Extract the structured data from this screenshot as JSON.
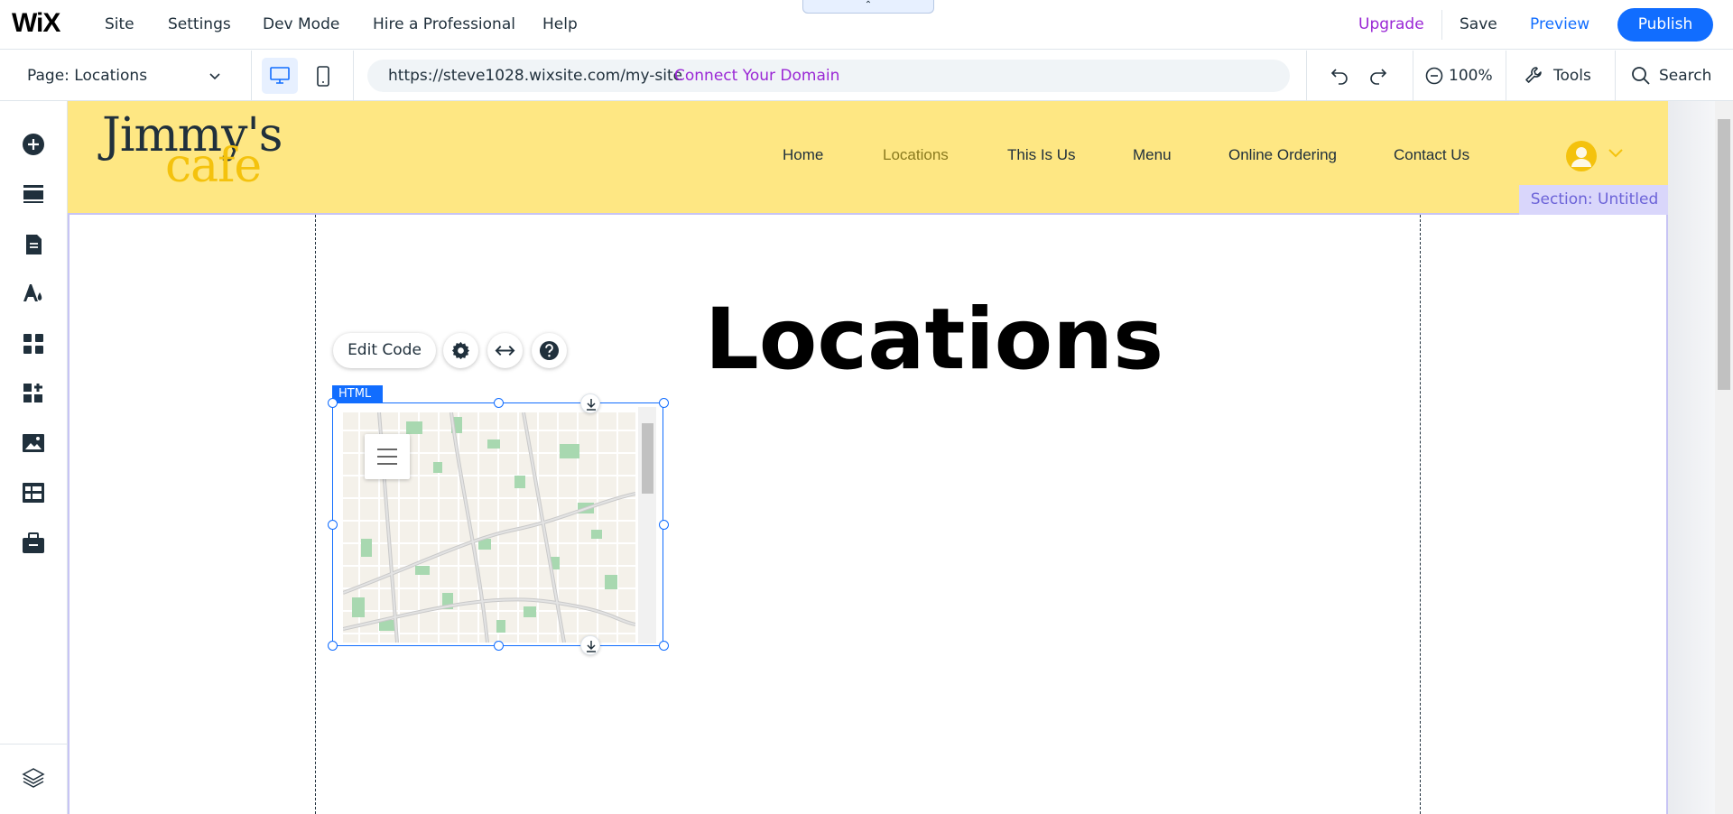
{
  "topbar": {
    "logo": "WiX",
    "nav": [
      "Site",
      "Settings",
      "Dev Mode",
      "Hire a Professional",
      "Help"
    ],
    "upgrade": "Upgrade",
    "save": "Save",
    "preview": "Preview",
    "publish": "Publish",
    "collapse_handle": "⌃"
  },
  "bar2": {
    "page_label": "Page: Locations",
    "url": "https://steve1028.wixsite.com/my-site",
    "connect_domain": "Connect Your Domain",
    "zoom": "100%",
    "tools": "Tools",
    "search": "Search"
  },
  "sidebar": {
    "icons": [
      "add-icon",
      "sections-icon",
      "pages-icon",
      "design-icon",
      "apps-icon",
      "add-apps-icon",
      "media-icon",
      "cms-icon",
      "business-icon",
      "layers-icon"
    ]
  },
  "site": {
    "logo_line1": "Jimmy's",
    "logo_line2": "cafe",
    "menu": [
      "Home",
      "Locations",
      "This Is Us",
      "Menu",
      "Online Ordering",
      "Contact Us"
    ],
    "active_menu": "Locations",
    "section_label": "Section: Untitled",
    "heading": "Locations"
  },
  "html_element": {
    "edit_code": "Edit Code",
    "tag": "HTML"
  },
  "colors": {
    "accent_blue": "#116dff",
    "upgrade_purple": "#9a27d5",
    "header_yellow": "#fee783",
    "logo_yellow": "#f4c20d",
    "section_label_bg": "#d9d6fb"
  }
}
